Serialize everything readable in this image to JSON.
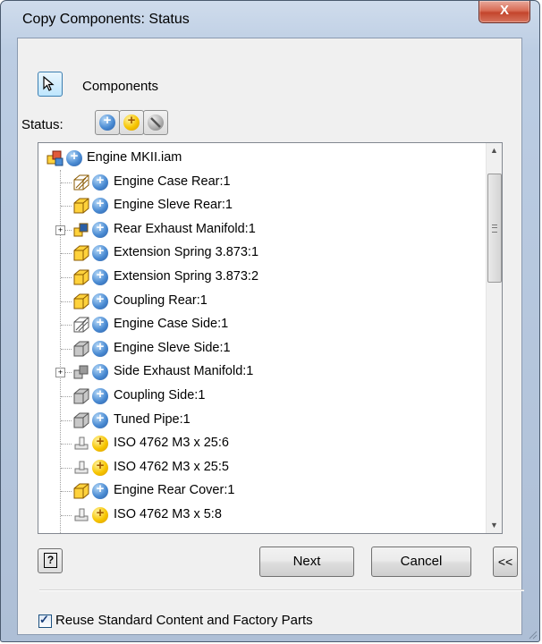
{
  "window": {
    "title": "Copy Components: Status",
    "close_glyph": "X"
  },
  "selection": {
    "button_icon": "select-cursor-icon",
    "label": "Components"
  },
  "status": {
    "label": "Status:",
    "buttons": [
      {
        "icon": "copy-status-plus-icon",
        "color": "#4a8bd3"
      },
      {
        "icon": "reuse-status-yellow-icon",
        "color": "#f7c500"
      },
      {
        "icon": "exclude-status-gray-icon",
        "color": "#a9a9a9"
      }
    ]
  },
  "tree": {
    "root": {
      "label": "Engine MKII.iam",
      "part_icon": "assembly-icon",
      "status": "copy"
    },
    "items": [
      {
        "label": "Engine Case Rear:1",
        "part_icon": "part-surface-yellow-icon",
        "status": "copy",
        "expandable": false
      },
      {
        "label": "Engine Sleve Rear:1",
        "part_icon": "part-yellow-icon",
        "status": "copy",
        "expandable": false
      },
      {
        "label": "Rear Exhaust Manifold:1",
        "part_icon": "subassembly-yellow-icon",
        "status": "copy",
        "expandable": true
      },
      {
        "label": "Extension Spring 3.873:1",
        "part_icon": "part-yellow-icon",
        "status": "copy",
        "expandable": false
      },
      {
        "label": "Extension Spring 3.873:2",
        "part_icon": "part-yellow-icon",
        "status": "copy",
        "expandable": false
      },
      {
        "label": "Coupling Rear:1",
        "part_icon": "part-yellow-icon",
        "status": "copy",
        "expandable": false
      },
      {
        "label": "Engine Case Side:1",
        "part_icon": "part-surface-gray-icon",
        "status": "copy",
        "expandable": false
      },
      {
        "label": "Engine Sleve Side:1",
        "part_icon": "part-gray-icon",
        "status": "copy",
        "expandable": false
      },
      {
        "label": "Side Exhaust Manifold:1",
        "part_icon": "subassembly-gray-icon",
        "status": "copy",
        "expandable": true
      },
      {
        "label": "Coupling Side:1",
        "part_icon": "part-gray-icon",
        "status": "copy",
        "expandable": false
      },
      {
        "label": "Tuned Pipe:1",
        "part_icon": "part-gray-icon",
        "status": "copy",
        "expandable": false
      },
      {
        "label": "ISO 4762 M3 x 25:6",
        "part_icon": "content-center-part-icon",
        "status": "reuse",
        "expandable": false
      },
      {
        "label": "ISO 4762 M3 x 25:5",
        "part_icon": "content-center-part-icon",
        "status": "reuse",
        "expandable": false
      },
      {
        "label": "Engine Rear Cover:1",
        "part_icon": "part-yellow-icon",
        "status": "copy",
        "expandable": false
      },
      {
        "label": "ISO 4762 M3 x 5:8",
        "part_icon": "content-center-part-icon",
        "status": "reuse",
        "expandable": false
      }
    ]
  },
  "buttons": {
    "help_glyph": "?",
    "next": "Next",
    "cancel": "Cancel",
    "collapse": "<<"
  },
  "options": {
    "reuse_label": "Reuse Standard Content and Factory Parts",
    "reuse_checked": true
  },
  "colors": {
    "copy_status": "#4a8bd3",
    "reuse_status": "#f7c500",
    "exclude_status": "#a9a9a9",
    "title_close": "#c3452c"
  }
}
